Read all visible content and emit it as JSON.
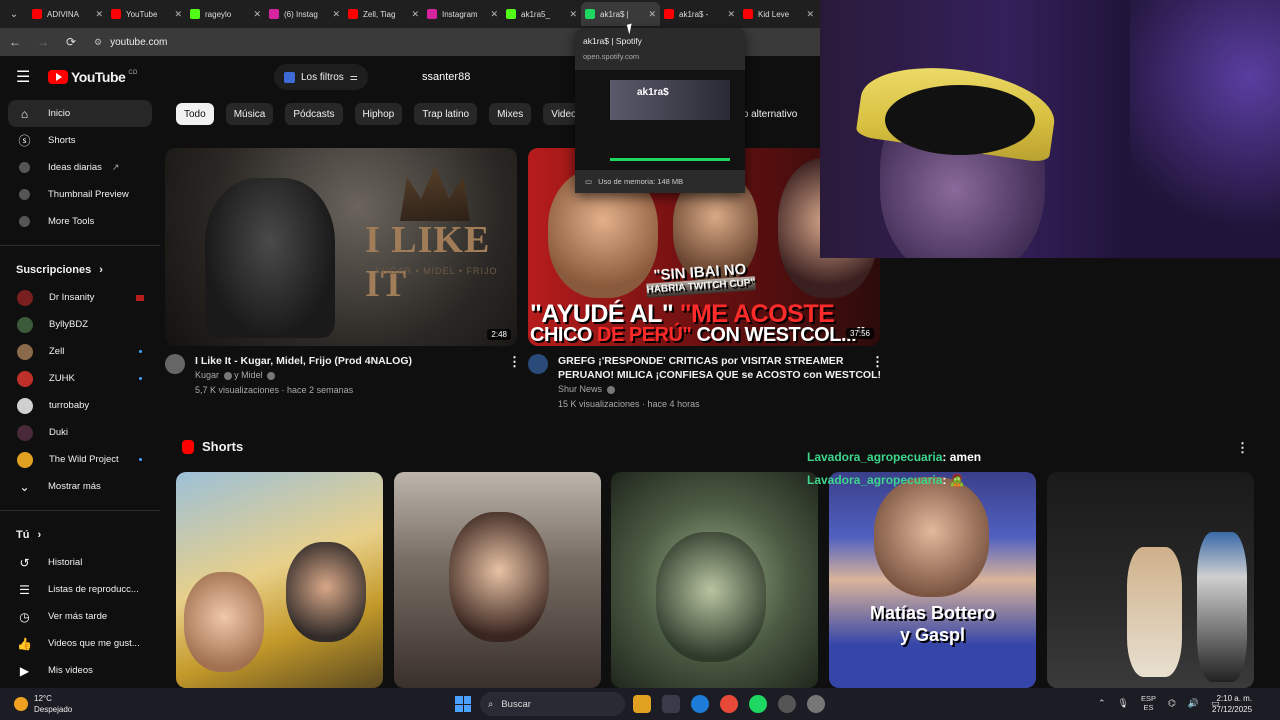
{
  "browser": {
    "tabs": [
      {
        "title": "ADIVINA",
        "color": "#ff0000"
      },
      {
        "title": "YouTube",
        "color": "#ff0000"
      },
      {
        "title": "rageylo",
        "color": "#53fc18"
      },
      {
        "title": "(6) Instag",
        "color": "#d6249f"
      },
      {
        "title": "Zell, Tiag",
        "color": "#ff0000"
      },
      {
        "title": "Instagram",
        "color": "#d6249f"
      },
      {
        "title": "ak1ra5_",
        "color": "#53fc18"
      },
      {
        "title": "ak1ra$ |",
        "color": "#1ed760"
      },
      {
        "title": "ak1ra$ -",
        "color": "#ff0000"
      },
      {
        "title": "Kid Leve",
        "color": "#ff0000"
      }
    ],
    "url": "youtube.com",
    "tab_preview": {
      "title": "ak1ra$ | Spotify",
      "url": "open.spotify.com",
      "art_title": "ak1ra$",
      "memory": "Uso de memoria: 148 MB"
    }
  },
  "header": {
    "logo_text": "YouTube",
    "country": "CO",
    "filters_label": "Los filtros",
    "search_value": "ssanter88"
  },
  "chips": [
    "Todo",
    "Música",
    "Pódcasts",
    "Hiphop",
    "Trap latino",
    "Mixes",
    "Videojuegos"
  ],
  "chip_tail": "Hop alternativo",
  "sidebar": {
    "main": [
      {
        "label": "Inicio",
        "icon": "home-icon"
      },
      {
        "label": "Shorts",
        "icon": "shorts-icon"
      },
      {
        "label": "Ideas diarias",
        "icon": "app-icon"
      },
      {
        "label": "Thumbnail Preview",
        "icon": "app-icon"
      },
      {
        "label": "More Tools",
        "icon": "app-icon"
      }
    ],
    "subscriptions_title": "Suscripciones",
    "subscriptions": [
      {
        "label": "Dr Insanity",
        "color": "#7a1f1f",
        "badge": "live"
      },
      {
        "label": "ByllyBDZ",
        "color": "#3a5a3a",
        "badge": ""
      },
      {
        "label": "Zell",
        "color": "#8a6a4a",
        "badge": "dot"
      },
      {
        "label": "ZUHK",
        "color": "#c0302a",
        "badge": "dot"
      },
      {
        "label": "turrobaby",
        "color": "#d0d0d0",
        "badge": ""
      },
      {
        "label": "Duki",
        "color": "#4a2a3a",
        "badge": ""
      },
      {
        "label": "The Wild Project",
        "color": "#e0a020",
        "badge": "dot"
      }
    ],
    "show_more": "Mostrar más",
    "you_title": "Tú",
    "you_items": [
      {
        "label": "Historial",
        "icon": "history-icon"
      },
      {
        "label": "Listas de reproducc...",
        "icon": "playlist-icon"
      },
      {
        "label": "Ver más tarde",
        "icon": "clock-icon"
      },
      {
        "label": "Videos que me gust...",
        "icon": "thumbs-up-icon"
      },
      {
        "label": "Mis videos",
        "icon": "video-icon"
      }
    ]
  },
  "videos": [
    {
      "title": "I Like It - Kugar, Midel, Frijo (Prod 4NALOG)",
      "channel": "Kugar",
      "channel_extra": "y Midel",
      "stats": "5,7 K visualizaciones · hace 2 semanas",
      "duration": "2:48",
      "thumb_text": "I LIKE IT",
      "thumb_sub": "KUGAR • MIDEL • FRIJO"
    },
    {
      "title_line1": "GREFG ¡'RESPONDE' CRITICAS por VISITAR STREAMER",
      "title_line2": "PERUANO! MILICA ¡CONFIESA QUE se ACOSTO con WESTCOL!",
      "channel": "Shur News",
      "stats": "15 K visualizaciones · hace 4 horas",
      "duration": "37:56",
      "thumb_badge_1": "\"SIN IBAI NO",
      "thumb_badge_2": "HABRIA TWITCH CUP\"",
      "thumb_line1_a": "\"AYUDÉ AL\"",
      "thumb_line1_b": "\"ME ACOSTE",
      "thumb_line2_a": "CHICO",
      "thumb_line2_b": "DE PERÚ\"",
      "thumb_line2_c": "CON WESTCOL...\""
    }
  ],
  "shorts": {
    "title": "Shorts",
    "short4_caption_1": "Matías Bottero",
    "short4_caption_2": "y Gaspl"
  },
  "chat": [
    {
      "user": "Lavadora_agropecuaria",
      "msg": ": amen"
    },
    {
      "user": "Lavadora_agropecuaria",
      "msg": ": 🧟"
    }
  ],
  "taskbar": {
    "temp": "12°C",
    "weather": "Despejado",
    "search": "Buscar",
    "lang1": "ESP",
    "lang2": "ES",
    "time": "2:10 a. m.",
    "date": "27/12/2025"
  }
}
